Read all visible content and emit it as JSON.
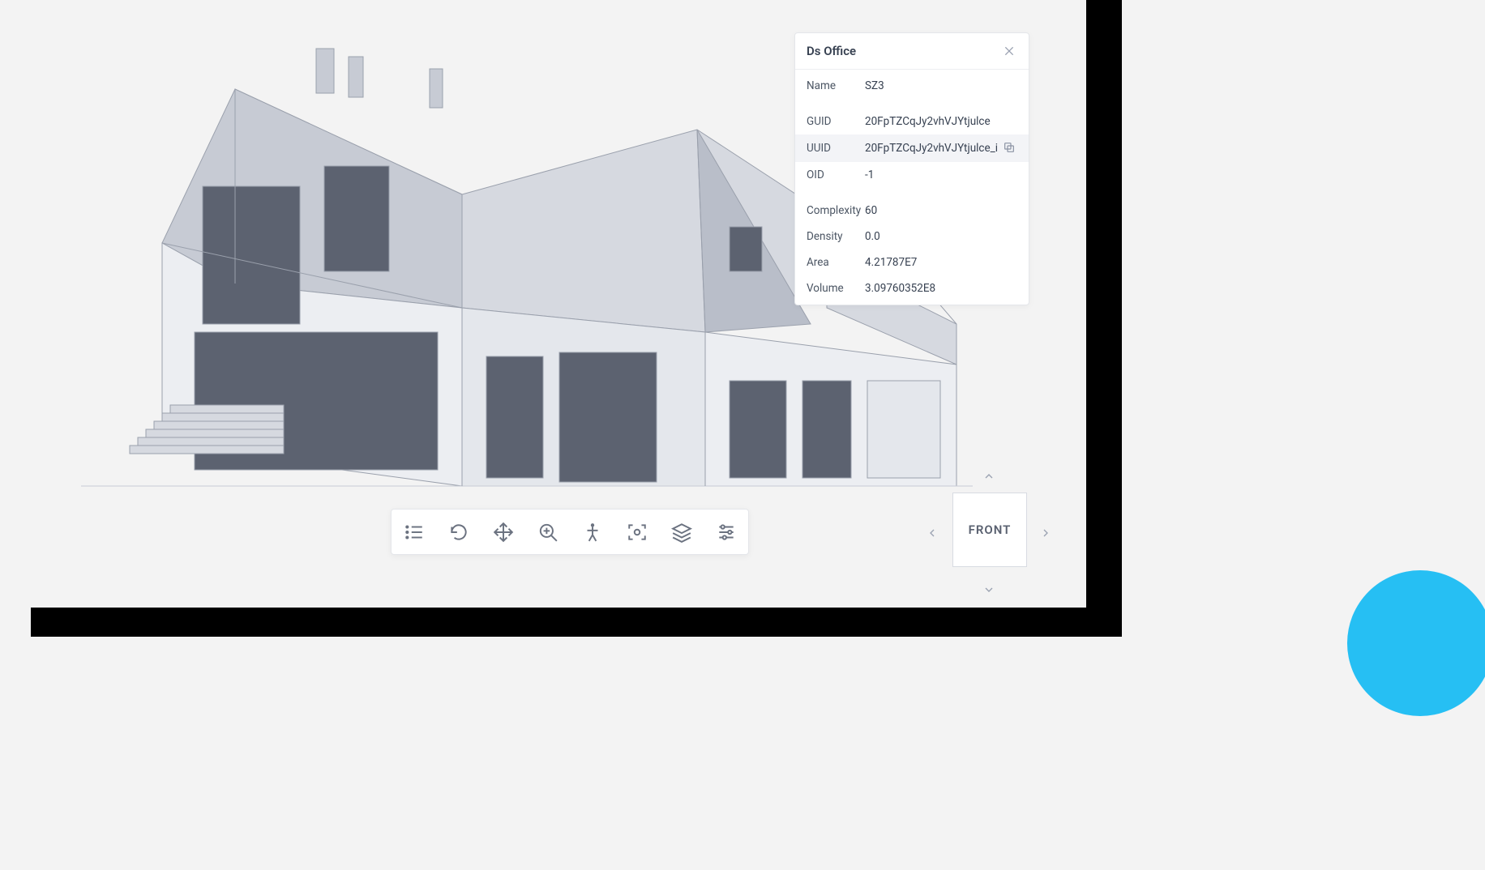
{
  "panel": {
    "title": "Ds Office",
    "rows": [
      {
        "label": "Name",
        "value": "SZ3"
      },
      {
        "gap": true
      },
      {
        "label": "GUID",
        "value": "20FpTZCqJy2vhVJYtjulce"
      },
      {
        "label": "UUID",
        "value": "20FpTZCqJy2vhVJYtjulce_i",
        "highlight": true,
        "copy": true
      },
      {
        "label": "OID",
        "value": "-1"
      },
      {
        "gap": true
      },
      {
        "label": "Complexity",
        "value": "60"
      },
      {
        "label": "Density",
        "value": "0.0"
      },
      {
        "label": "Area",
        "value": "4.21787E7"
      },
      {
        "label": "Volume",
        "value": "3.09760352E8"
      }
    ]
  },
  "toolbar": {
    "icons": [
      "list-icon",
      "orbit-icon",
      "pan-icon",
      "zoom-icon",
      "person-icon",
      "focus-icon",
      "layers-icon",
      "sliders-icon"
    ]
  },
  "cube": {
    "face": "FRONT"
  }
}
